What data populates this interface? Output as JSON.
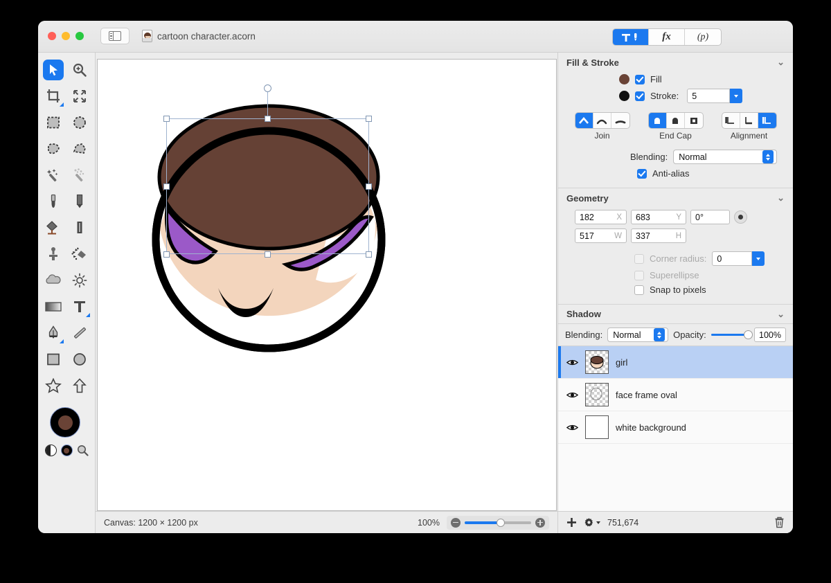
{
  "window": {
    "document_title": "cartoon character.acorn",
    "traffic_lights": [
      "close-button",
      "minimize-button",
      "maximize-button"
    ],
    "sidebar_toggle_icon": "sidebar-toggle-icon",
    "document_icon": "acorn-document-icon"
  },
  "toolbar": {
    "segments": [
      {
        "name": "inspector-tools",
        "icon": "hammer-pen-icon",
        "label": "",
        "active": true
      },
      {
        "name": "filters",
        "icon": "fx-icon",
        "label": "fx",
        "active": false
      },
      {
        "name": "presets",
        "icon": "palette-icon",
        "label": "(p)",
        "active": false
      }
    ]
  },
  "tools": {
    "items": [
      {
        "icon": "move-selection-icon",
        "selected": true,
        "badge": false
      },
      {
        "icon": "zoom-tool-icon",
        "selected": false,
        "badge": false
      },
      {
        "icon": "crop-tool-icon",
        "selected": false,
        "badge": true
      },
      {
        "icon": "transform-tool-icon",
        "selected": false,
        "badge": false
      },
      {
        "icon": "rect-select-icon",
        "selected": false,
        "badge": false
      },
      {
        "icon": "ellipse-select-icon",
        "selected": false,
        "badge": false
      },
      {
        "icon": "lasso-select-icon",
        "selected": false,
        "badge": false
      },
      {
        "icon": "polygon-select-icon",
        "selected": false,
        "badge": false
      },
      {
        "icon": "magic-wand-icon",
        "selected": false,
        "badge": false
      },
      {
        "icon": "instant-alpha-icon",
        "selected": false,
        "badge": false
      },
      {
        "icon": "brush-tool-icon",
        "selected": false,
        "badge": false
      },
      {
        "icon": "pencil-tool-icon",
        "selected": false,
        "badge": false
      },
      {
        "icon": "paint-bucket-icon",
        "selected": false,
        "badge": false
      },
      {
        "icon": "eraser-tool-icon",
        "selected": false,
        "badge": false
      },
      {
        "icon": "clone-stamp-icon",
        "selected": false,
        "badge": false
      },
      {
        "icon": "smudge-tool-icon",
        "selected": false,
        "badge": false
      },
      {
        "icon": "blur-tool-icon",
        "selected": false,
        "badge": false
      },
      {
        "icon": "dodge-burn-icon",
        "selected": false,
        "badge": false
      },
      {
        "icon": "gradient-tool-icon",
        "selected": false,
        "badge": false
      },
      {
        "icon": "text-tool-icon",
        "selected": false,
        "badge": true
      },
      {
        "icon": "bezier-pen-icon",
        "selected": false,
        "badge": true
      },
      {
        "icon": "line-tool-icon",
        "selected": false,
        "badge": false
      },
      {
        "icon": "rectangle-shape-icon",
        "selected": false,
        "badge": false
      },
      {
        "icon": "ellipse-shape-icon",
        "selected": false,
        "badge": false
      },
      {
        "icon": "star-shape-icon",
        "selected": false,
        "badge": false
      },
      {
        "icon": "arrow-shape-icon",
        "selected": false,
        "badge": false
      }
    ],
    "color_swatch": {
      "stroke_color": "#000000",
      "fill_color": "#6A4336",
      "halfcircle_icon": "grayscale-toggle-icon",
      "reset_icon": "reset-colors-icon",
      "picker_icon": "color-picker-icon"
    }
  },
  "canvas": {
    "artwork_name": "cartoon-girl-face",
    "colors": {
      "hair": "#654135",
      "skin": "#F3D5BD",
      "purple": "#9B59C8",
      "outline": "#000000",
      "white": "#FFFFFF"
    },
    "selection": {
      "handle_count": 8,
      "rotation_handle": true
    }
  },
  "status": {
    "canvas_label": "Canvas: 1200 × 1200 px",
    "zoom_level": "100%",
    "zoom_out_icon": "zoom-out-icon",
    "zoom_in_icon": "zoom-in-icon"
  },
  "inspector": {
    "fill_stroke": {
      "title": "Fill & Stroke",
      "collapse_icon": "chevron-down-icon",
      "fill": {
        "label": "Fill",
        "checked": true,
        "color": "#6A4336"
      },
      "stroke": {
        "label": "Stroke:",
        "checked": true,
        "color": "#111111",
        "width": "5"
      },
      "join": {
        "label": "Join",
        "options": [
          "miter-join-icon",
          "round-join-icon",
          "bevel-join-icon"
        ],
        "selected_index": 0
      },
      "end_cap": {
        "label": "End Cap",
        "options": [
          "butt-cap-icon",
          "round-cap-icon",
          "square-cap-icon"
        ],
        "selected_index": 0
      },
      "alignment": {
        "label": "Alignment",
        "options": [
          "align-inside-icon",
          "align-center-icon",
          "align-outside-icon"
        ],
        "selected_index": 2
      },
      "blending": {
        "label": "Blending:",
        "value": "Normal"
      },
      "antialias": {
        "label": "Anti-alias",
        "checked": true
      }
    },
    "geometry": {
      "title": "Geometry",
      "collapse_icon": "chevron-down-icon",
      "x": {
        "value": "182",
        "unit": "X"
      },
      "y": {
        "value": "683",
        "unit": "Y"
      },
      "rotation": {
        "value": "0°"
      },
      "rotation_dial_icon": "rotation-dial-icon",
      "w": {
        "value": "517",
        "unit": "W"
      },
      "h": {
        "value": "337",
        "unit": "H"
      },
      "corner_radius": {
        "label": "Corner radius:",
        "checked": false,
        "enabled": false,
        "value": "0"
      },
      "superellipse": {
        "label": "Superellipse",
        "checked": false,
        "enabled": false
      },
      "snap_to_pixels": {
        "label": "Snap to pixels",
        "checked": false,
        "enabled": true
      }
    },
    "shadow": {
      "title": "Shadow",
      "collapse_icon": "chevron-down-icon",
      "blending": {
        "label": "Blending:",
        "value": "Normal"
      },
      "opacity": {
        "label": "Opacity:",
        "value": "100%",
        "percent": 100
      }
    },
    "layers": [
      {
        "name": "girl",
        "selected": true,
        "visible": true,
        "thumb": "girl-thumbnail",
        "eye_icon": "eye-icon"
      },
      {
        "name": "face frame oval",
        "selected": false,
        "visible": true,
        "thumb": "oval-thumbnail",
        "eye_icon": "eye-icon"
      },
      {
        "name": "white background",
        "selected": false,
        "visible": true,
        "thumb": "white-thumbnail",
        "eye_icon": "eye-icon"
      }
    ],
    "layers_bar": {
      "add_icon": "plus-icon",
      "settings_icon": "gear-dropdown-icon",
      "memory": "751,674",
      "delete_icon": "trash-icon"
    }
  }
}
